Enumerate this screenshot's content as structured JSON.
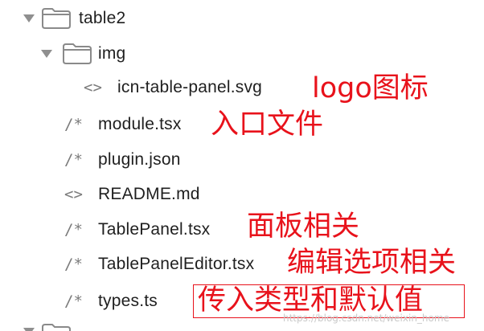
{
  "tree": {
    "items": [
      {
        "label": "table2",
        "type": "folder",
        "expanded": true
      },
      {
        "label": "img",
        "type": "folder",
        "expanded": true
      },
      {
        "label": "icn-table-panel.svg",
        "type": "file",
        "icon": "code-brackets-icon",
        "glyph": "<>"
      },
      {
        "label": "module.tsx",
        "type": "file",
        "icon": "comment-slash-star-icon",
        "glyph": "/*"
      },
      {
        "label": "plugin.json",
        "type": "file",
        "icon": "comment-slash-star-icon",
        "glyph": "/*"
      },
      {
        "label": "README.md",
        "type": "file",
        "icon": "code-brackets-icon",
        "glyph": "<>"
      },
      {
        "label": "TablePanel.tsx",
        "type": "file",
        "icon": "comment-slash-star-icon",
        "glyph": "/*"
      },
      {
        "label": "TablePanelEditor.tsx",
        "type": "file",
        "icon": "comment-slash-star-icon",
        "glyph": "/*"
      },
      {
        "label": "types.ts",
        "type": "file",
        "icon": "comment-slash-star-icon",
        "glyph": "/*"
      }
    ]
  },
  "annotations": {
    "logo_icon": "logo图标",
    "entry_file": "入口文件",
    "panel_related": "面板相关",
    "editor_options": "编辑选项相关",
    "types_defaults": "传入类型和默认值"
  },
  "watermark": "https://blog.csdn.net/weixin_home",
  "colors": {
    "annotation": "#e8121b",
    "icon_gray": "#8f8f8f",
    "text": "#1f1f1f"
  }
}
